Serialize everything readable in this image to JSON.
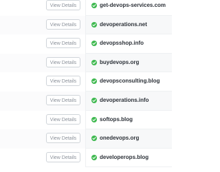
{
  "rows": [
    {
      "button_label": "View Details",
      "domain": "get-devops-services.com",
      "status_icon": "check-circle-icon"
    },
    {
      "button_label": "View Details",
      "domain": "devoperations.net",
      "status_icon": "check-circle-icon"
    },
    {
      "button_label": "View Details",
      "domain": "devopsshop.info",
      "status_icon": "check-circle-icon"
    },
    {
      "button_label": "View Details",
      "domain": "buydevops.org",
      "status_icon": "check-circle-icon"
    },
    {
      "button_label": "View Details",
      "domain": "devopsconsulting.blog",
      "status_icon": "check-circle-icon"
    },
    {
      "button_label": "View Details",
      "domain": "devoperations.info",
      "status_icon": "check-circle-icon"
    },
    {
      "button_label": "View Details",
      "domain": "softops.blog",
      "status_icon": "check-circle-icon"
    },
    {
      "button_label": "View Details",
      "domain": "onedevops.org",
      "status_icon": "check-circle-icon"
    },
    {
      "button_label": "View Details",
      "domain": "developerops.blog",
      "status_icon": "check-circle-icon"
    }
  ],
  "colors": {
    "check": "#3fb950",
    "domain_text": "#2c3138",
    "button_text": "#8a9099",
    "button_border": "#cfd4d9"
  }
}
